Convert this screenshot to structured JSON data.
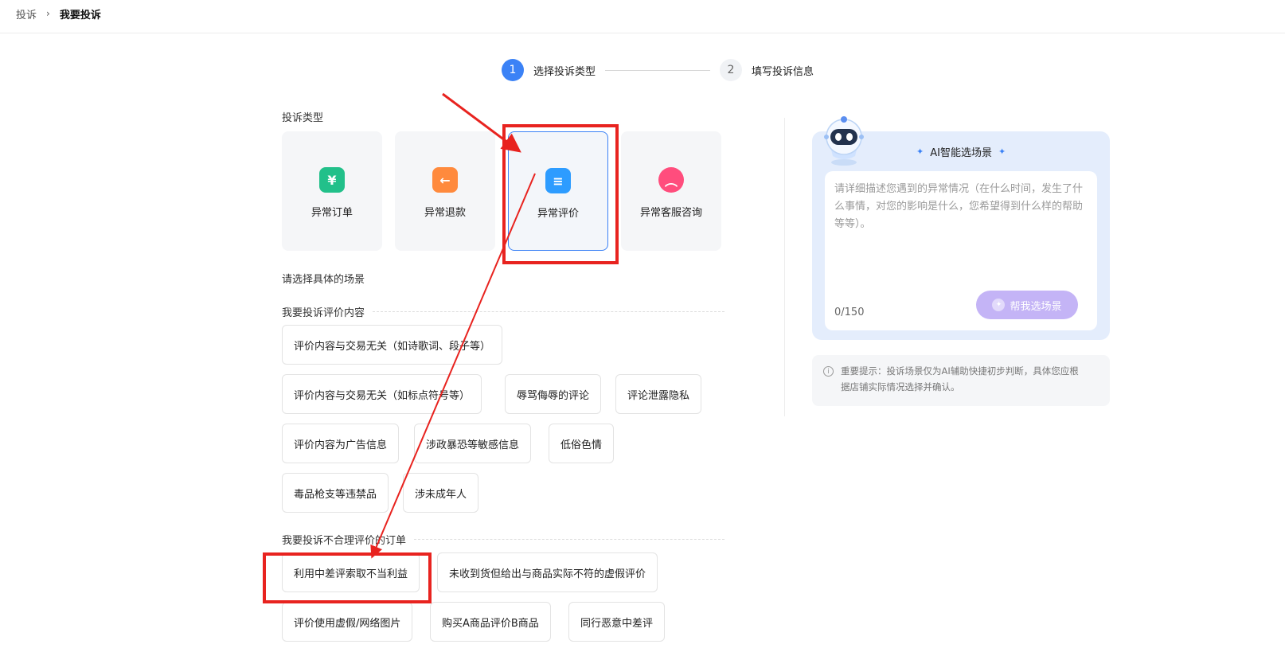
{
  "breadcrumb": {
    "parent": "投诉",
    "separator": "›",
    "current": "我要投诉"
  },
  "stepper": {
    "steps": [
      {
        "number": "1",
        "label": "选择投诉类型",
        "active": true
      },
      {
        "number": "2",
        "label": "填写投诉信息",
        "active": false
      }
    ]
  },
  "complaint_type": {
    "title": "投诉类型",
    "selected": "异常评价",
    "types": [
      {
        "label": "异常订单",
        "icon": "yen-receipt-icon",
        "icon_glyph": "¥",
        "color": "#22c08a"
      },
      {
        "label": "异常退款",
        "icon": "refund-arrow-icon",
        "icon_glyph": "←",
        "color": "#ff8a3d"
      },
      {
        "label": "异常评价",
        "icon": "edit-review-icon",
        "icon_glyph": "≡",
        "color": "#2d9cff"
      },
      {
        "label": "异常客服咨询",
        "icon": "sad-chat-icon",
        "icon_glyph": "︵",
        "color": "#ff4d7d"
      }
    ]
  },
  "scene": {
    "title": "请选择具体的场景",
    "groups": [
      {
        "title": "我要投诉评价内容",
        "chips": [
          "评价内容与交易无关（如诗歌词、段子等）",
          "评价内容与交易无关（如标点符号等）",
          "辱骂侮辱的评论",
          "评论泄露隐私",
          "评价内容为广告信息",
          "涉政暴恐等敏感信息",
          "低俗色情",
          "毒品枪支等违禁品",
          "涉未成年人"
        ]
      },
      {
        "title": "我要投诉不合理评价的订单",
        "chips": [
          "利用中差评索取不当利益",
          "未收到货但给出与商品实际不符的虚假评价",
          "评价使用虚假/网络图片",
          "购买A商品评价B商品",
          "同行恶意中差评"
        ]
      }
    ]
  },
  "ai_panel": {
    "title": "AI智能选场景",
    "placeholder": "请详细描述您遇到的异常情况（在什么时间，发生了什么事情，对您的影响是什么，您希望得到什么样的帮助等等）。",
    "counter": "0/150",
    "button_label": "帮我选场景",
    "background_color": "#e4edfc",
    "button_color": "#c4b4f6"
  },
  "notice": {
    "text": "重要提示：投诉场景仅为AI辅助快捷初步判断，具体您应根据店铺实际情况选择并确认。"
  },
  "annotations": {
    "arrow_color": "#e8231f"
  }
}
